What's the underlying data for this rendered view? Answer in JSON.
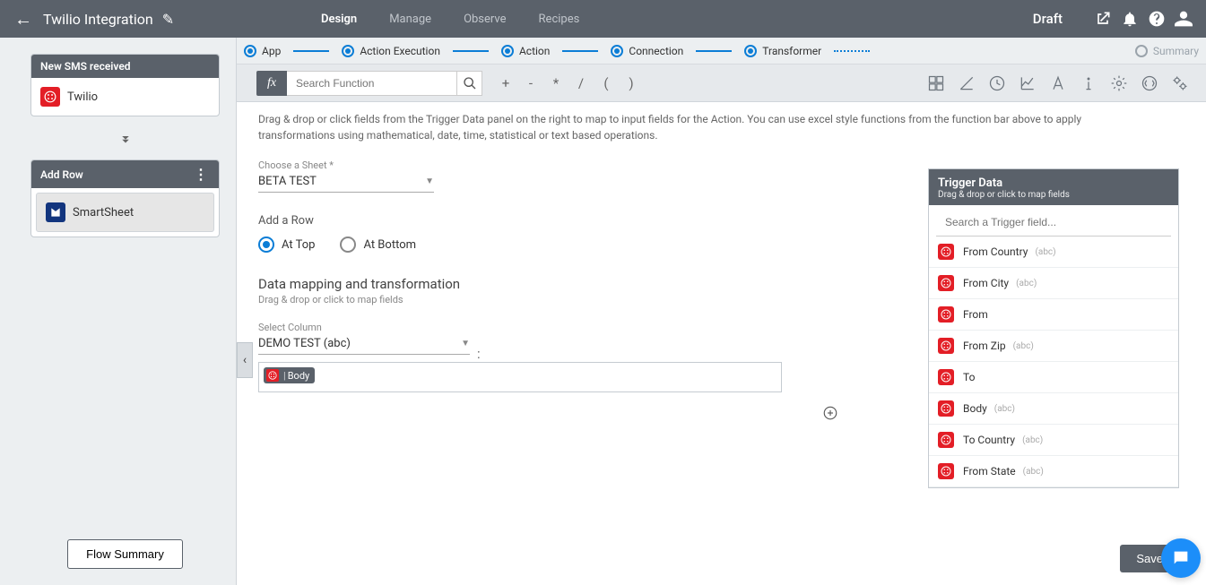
{
  "header": {
    "title": "Twilio Integration",
    "nav": [
      "Design",
      "Manage",
      "Observe",
      "Recipes"
    ],
    "active_nav": "Design",
    "status": "Draft"
  },
  "sidebar": {
    "trigger_card": {
      "title": "New SMS received",
      "provider": "Twilio"
    },
    "action_card": {
      "title": "Add Row",
      "provider": "SmartSheet"
    },
    "summary_btn": "Flow Summary"
  },
  "stepper": {
    "steps": [
      "App",
      "Action Execution",
      "Action",
      "Connection",
      "Transformer",
      "Summary"
    ]
  },
  "funcbar": {
    "fx": "fx",
    "search_placeholder": "Search Function",
    "ops": [
      "+",
      "-",
      "*",
      "/",
      "(",
      ")"
    ]
  },
  "content": {
    "desc": "Drag & drop or click fields from the Trigger Data panel on the right to map to input fields for the Action. You can use excel style functions from the function bar above to apply transformations using mathematical, date, time, statistical or text based operations.",
    "sheet_label": "Choose a Sheet *",
    "sheet_value": "BETA TEST",
    "addrow_label": "Add a Row",
    "radio_top": "At Top",
    "radio_bottom": "At Bottom",
    "mapping_title": "Data mapping and transformation",
    "mapping_sub": "Drag & drop or click to map fields",
    "col_label": "Select Column",
    "col_value": "DEMO TEST (abc)",
    "token_label": "Body"
  },
  "trigger_panel": {
    "title": "Trigger Data",
    "sub": "Drag & drop or click to map fields",
    "search_placeholder": "Search a Trigger field...",
    "items": [
      {
        "label": "From Country",
        "type": "(abc)"
      },
      {
        "label": "From City",
        "type": "(abc)"
      },
      {
        "label": "From",
        "type": ""
      },
      {
        "label": "From Zip",
        "type": "(abc)"
      },
      {
        "label": "To",
        "type": ""
      },
      {
        "label": "Body",
        "type": "(abc)"
      },
      {
        "label": "To Country",
        "type": "(abc)"
      },
      {
        "label": "From State",
        "type": "(abc)"
      }
    ]
  },
  "save_btn": "Save"
}
